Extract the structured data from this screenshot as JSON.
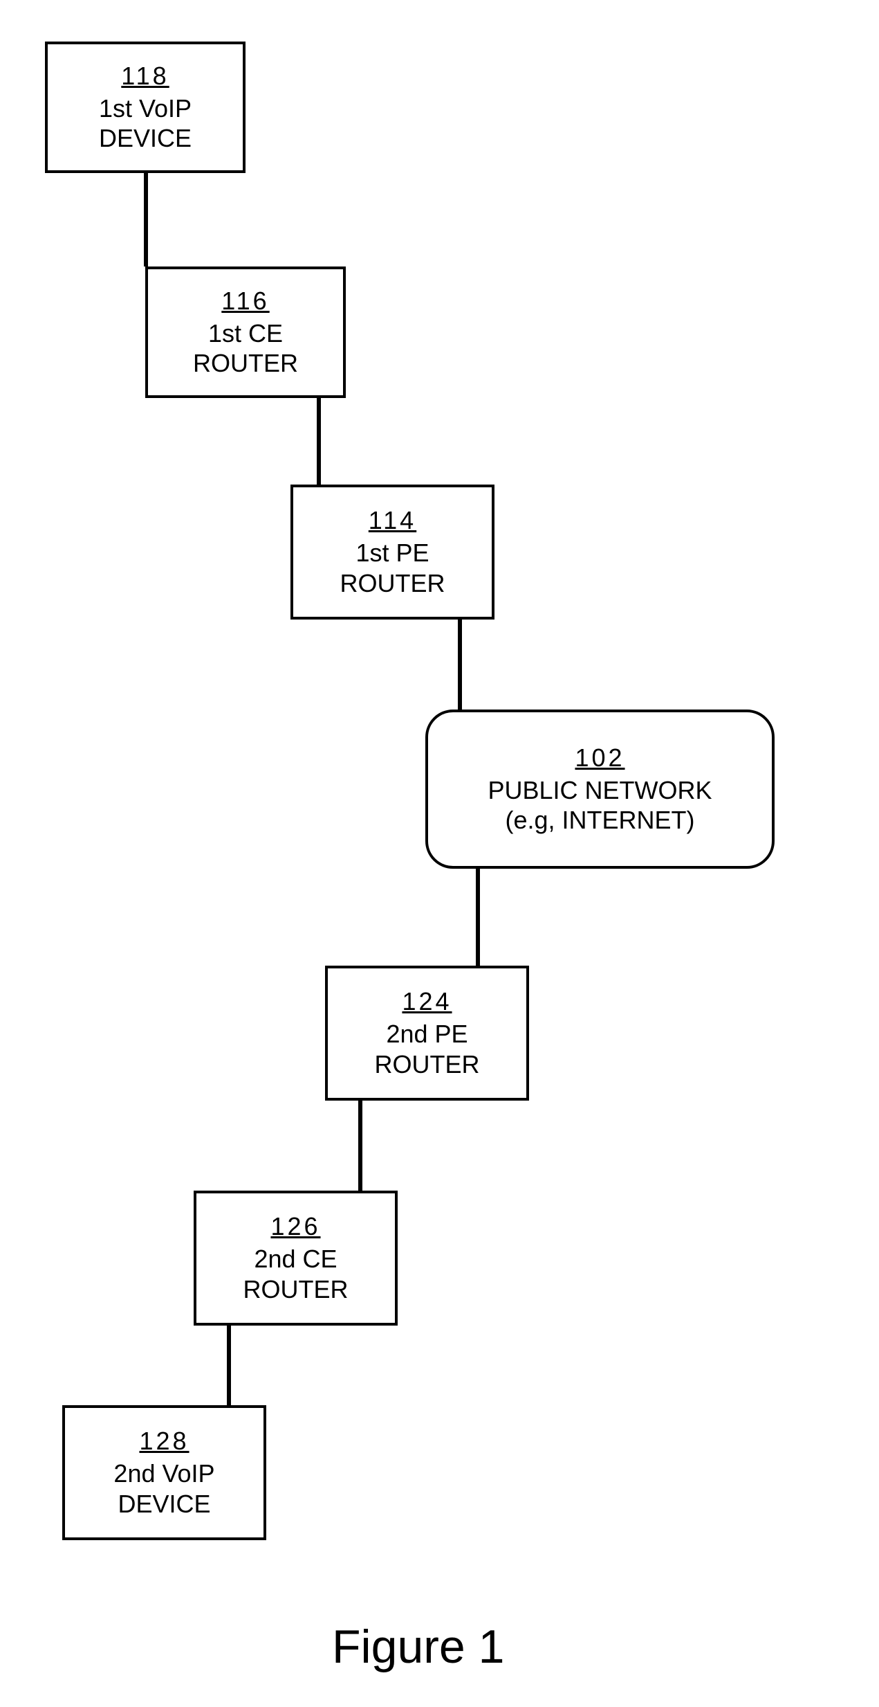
{
  "nodes": {
    "n118": {
      "ref": "118",
      "label": "1st VoIP\nDEVICE"
    },
    "n116": {
      "ref": "116",
      "label": "1st CE\nROUTER"
    },
    "n114": {
      "ref": "114",
      "label": "1st PE\nROUTER"
    },
    "n102": {
      "ref": "102",
      "label": "PUBLIC NETWORK\n(e.g, INTERNET)"
    },
    "n124": {
      "ref": "124",
      "label": "2nd PE\nROUTER"
    },
    "n126": {
      "ref": "126",
      "label": "2nd CE\nROUTER"
    },
    "n128": {
      "ref": "128",
      "label": "2nd VoIP\nDEVICE"
    }
  },
  "caption": "Figure 1"
}
